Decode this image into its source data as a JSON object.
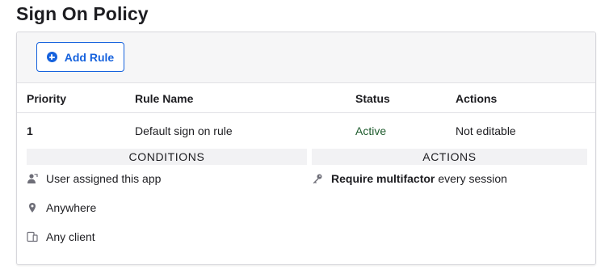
{
  "page": {
    "title": "Sign On Policy"
  },
  "toolbar": {
    "add_rule_label": "Add Rule",
    "add_icon": "plus-circle-icon"
  },
  "table": {
    "headers": {
      "priority": "Priority",
      "rule_name": "Rule Name",
      "status": "Status",
      "actions": "Actions"
    },
    "row": {
      "priority": "1",
      "rule_name": "Default sign on rule",
      "status": "Active",
      "actions": "Not editable"
    }
  },
  "sections": {
    "conditions": "CONDITIONS",
    "actions": "ACTIONS"
  },
  "conditions": [
    {
      "icon": "user-assigned-icon",
      "label": "User assigned this app"
    },
    {
      "icon": "location-pin-icon",
      "label": "Anywhere"
    },
    {
      "icon": "devices-icon",
      "label": "Any client"
    }
  ],
  "actions": {
    "icon": "key-icon",
    "strong": "Require multifactor",
    "rest": "every session"
  },
  "colors": {
    "accent": "#1662dd",
    "status_active": "#1e5b2d",
    "band": "#f2f2f4"
  }
}
